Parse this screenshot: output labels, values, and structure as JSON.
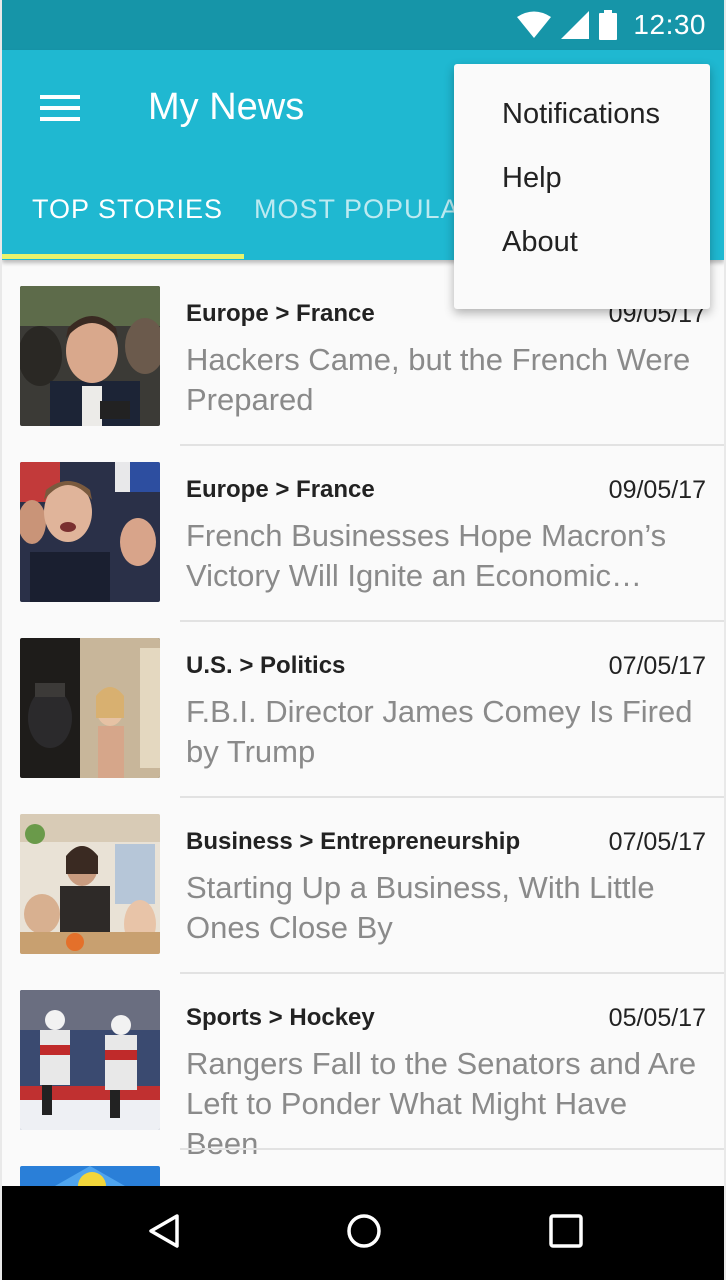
{
  "status_bar": {
    "time": "12:30"
  },
  "app_bar": {
    "title": "My News"
  },
  "tabs": [
    {
      "label": "TOP STORIES",
      "selected": true
    },
    {
      "label": "MOST POPULA"
    }
  ],
  "overflow_menu": [
    {
      "label": "Notifications"
    },
    {
      "label": "Help"
    },
    {
      "label": "About"
    }
  ],
  "articles": [
    {
      "category": "Europe > France",
      "date": "09/05/17",
      "headline": "Hackers Came, but the French Were Prepared"
    },
    {
      "category": "Europe > France",
      "date": "09/05/17",
      "headline": "French Businesses Hope Macron’s Victory Will Ignite an Economic…"
    },
    {
      "category": "U.S. > Politics",
      "date": "07/05/17",
      "headline": "F.B.I. Director James Comey Is Fired by Trump"
    },
    {
      "category": "Business > Entrepreneurship",
      "date": "07/05/17",
      "headline": "Starting Up a Business, With Little Ones Close By"
    },
    {
      "category": "Sports > Hockey",
      "date": "05/05/17",
      "headline": "Rangers Fall to the Senators and Are Left to Ponder What Might Have Been"
    }
  ],
  "colors": {
    "status_bar": "#1695a8",
    "app_bar": "#1fb8d1",
    "tab_indicator": "#e8f36c"
  },
  "icons": [
    "wifi-icon",
    "signal-icon",
    "battery-icon",
    "hamburger-menu-icon",
    "back-icon",
    "home-icon",
    "recents-icon"
  ]
}
